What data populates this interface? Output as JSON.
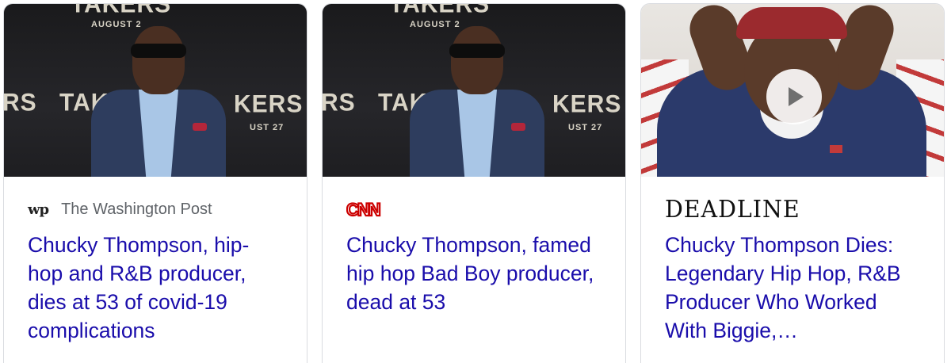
{
  "cards": [
    {
      "source_name": "The Washington Post",
      "source_logo_text": "wp",
      "headline": "Chucky Thompson, hip-hop and R&B producer, dies at 53 of covid-19 complications",
      "image": {
        "backdrop_top": "TAKERS",
        "backdrop_date": "AUGUST 2",
        "backdrop_left": "RS",
        "backdrop_mid": "TAK",
        "backdrop_right": "KERS",
        "backdrop_sub": "UST 27"
      }
    },
    {
      "source_name": "CNN",
      "source_logo_text": "CNN",
      "headline": "Chucky Thompson, famed hip hop Bad Boy producer, dead at 53",
      "image": {
        "backdrop_top": "TAKERS",
        "backdrop_date": "AUGUST 2",
        "backdrop_left": "RS",
        "backdrop_mid": "TAK",
        "backdrop_right": "KERS",
        "backdrop_sub": "UST 27"
      }
    },
    {
      "source_name": "DEADLINE",
      "source_logo_text": "DEADLINE",
      "headline": "Chucky Thompson Dies: Legendary Hip Hop, R&B Producer Who Worked With Biggie,…",
      "image": {
        "has_play_button": true
      }
    }
  ],
  "colors": {
    "headline": "#1a0dab",
    "source_text": "#5f6368",
    "cnn_red": "#cc0000",
    "card_border": "#dadce0"
  },
  "icons": {
    "play": "play-icon"
  }
}
